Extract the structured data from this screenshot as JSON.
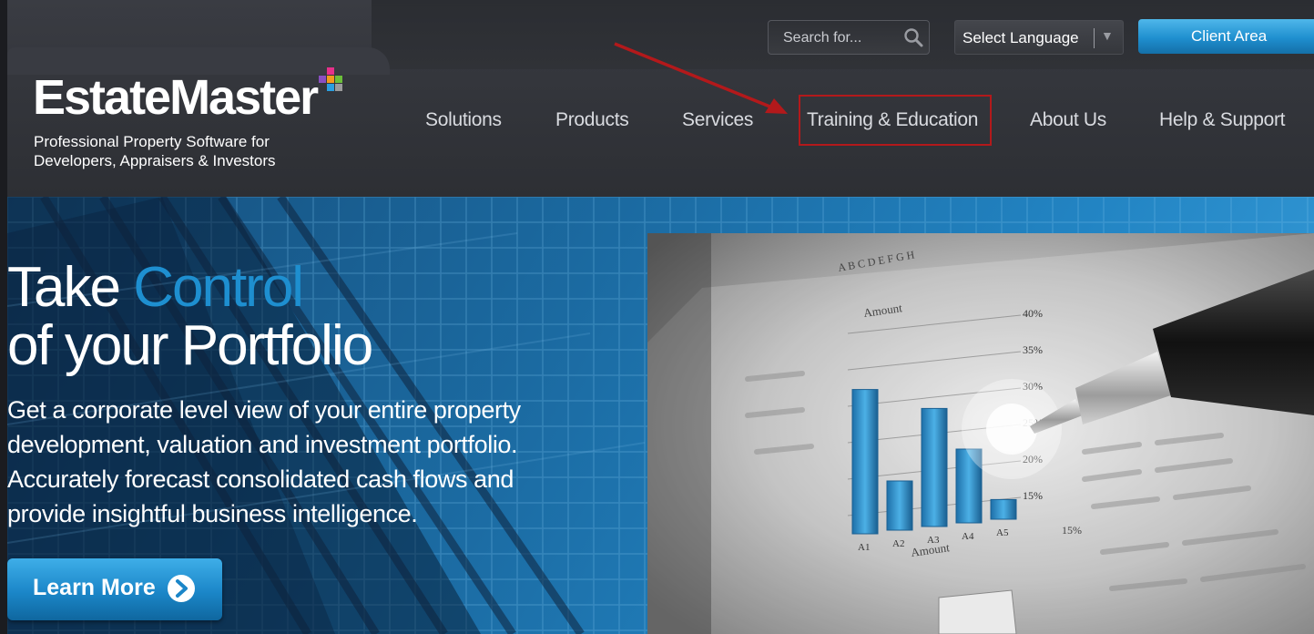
{
  "brand": {
    "name": "EstateMaster",
    "tagline_line1": "Professional Property Software for",
    "tagline_line2": "Developers, Appraisers & Investors",
    "square_colors": [
      "#e6308a",
      "#8a4fc1",
      "#f39a1e",
      "#6bbf3a",
      "#2a9fe0",
      "#9b9b9b"
    ]
  },
  "search": {
    "placeholder": "Search for..."
  },
  "language": {
    "label": "Select Language",
    "arrow": "▼"
  },
  "client_area": {
    "label": "Client Area"
  },
  "nav": {
    "items": [
      {
        "label": "Solutions"
      },
      {
        "label": "Products"
      },
      {
        "label": "Services"
      },
      {
        "label": "Training & Education",
        "highlighted": true
      },
      {
        "label": "About Us"
      },
      {
        "label": "Help & Support"
      }
    ]
  },
  "annotation": {
    "color": "#b3191b",
    "target": "Training & Education"
  },
  "hero": {
    "title_part1": "Take ",
    "title_accent": "Control",
    "title_line2": "of your Portfolio",
    "description": "Get a corporate level view of your entire property development, valuation and investment portfolio. Accurately forecast consolidated cash flows and provide insightful business intelligence.",
    "cta_label": "Learn More",
    "accent_color": "#1e8fd0"
  },
  "photo": {
    "amount_label": "Amount",
    "axis_letters": "A B C D E F G H",
    "bar_labels": [
      "A1",
      "A2",
      "A3",
      "A4",
      "A5"
    ],
    "bar_values": [
      0.88,
      0.3,
      0.72,
      0.45,
      0.12
    ],
    "percent_labels": [
      "40%",
      "35%",
      "30%",
      "25%",
      "20%",
      "15%"
    ],
    "lower_percent": "15%"
  }
}
